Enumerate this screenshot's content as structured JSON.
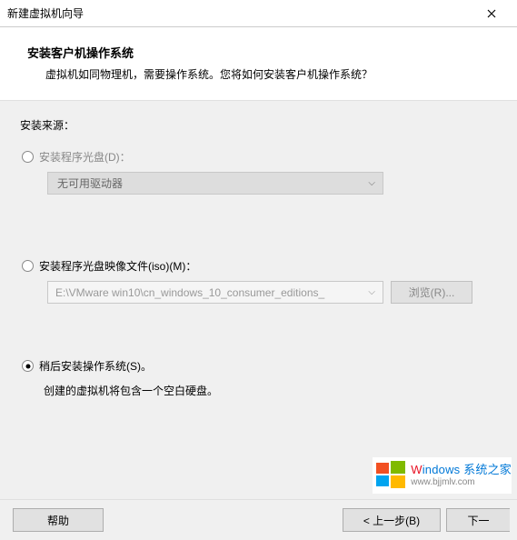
{
  "titlebar": {
    "title": "新建虚拟机向导"
  },
  "header": {
    "heading": "安装客户机操作系统",
    "subheading": "虚拟机如同物理机，需要操作系统。您将如何安装客户机操作系统？"
  },
  "source_label": "安装来源：",
  "options": {
    "disc": {
      "label": "安装程序光盘(D)：",
      "dropdown_text": "无可用驱动器"
    },
    "iso": {
      "label": "安装程序光盘映像文件(iso)(M)：",
      "path": "E:\\VMware win10\\cn_windows_10_consumer_editions_",
      "browse": "浏览(R)..."
    },
    "later": {
      "label": "稍后安装操作系统(S)。",
      "hint": "创建的虚拟机将包含一个空白硬盘。"
    }
  },
  "footer": {
    "help": "帮助",
    "back": "< 上一步(B)",
    "next": "下一"
  },
  "watermark": {
    "brand_w": "W",
    "brand_rest": "indows ",
    "brand_tail": "系统之家",
    "sub": "www.bjjmlv.com"
  }
}
